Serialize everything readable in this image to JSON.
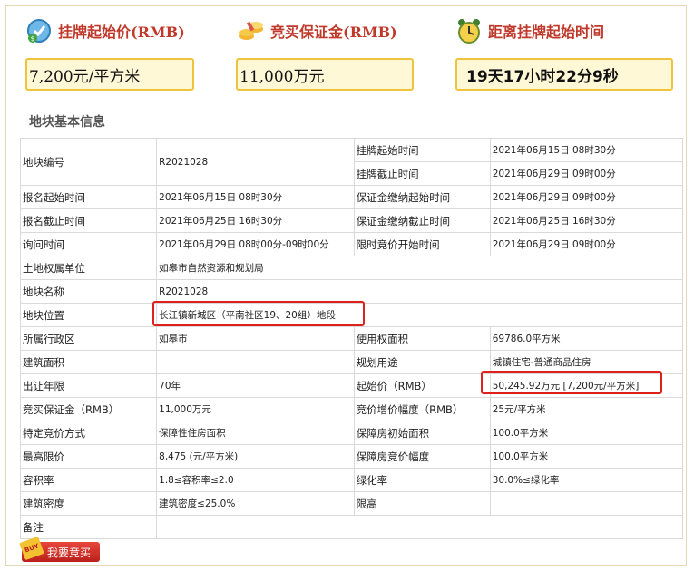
{
  "summary": {
    "start_price": {
      "title": "挂牌起始价(RMB)",
      "value": "7,200元/平方米",
      "icon": "price-tag-icon"
    },
    "deposit": {
      "title": "竞买保证金(RMB)",
      "value": "11,000万元",
      "icon": "coins-icon"
    },
    "countdown": {
      "title": "距离挂牌起始时间",
      "value": "19天17小时22分9秒",
      "icon": "alarm-clock-icon"
    }
  },
  "section_title": "地块基本信息",
  "table": {
    "r1": {
      "l1": "地块编号",
      "v1": "R2021028",
      "l2": "挂牌起始时间",
      "v2": "2021年06月15日 08时30分"
    },
    "r1b": {
      "l2": "挂牌截止时间",
      "v2": "2021年06月29日 09时00分"
    },
    "r2": {
      "l1": "报名起始时间",
      "v1": "2021年06月15日 08时30分",
      "l2": "保证金缴纳起始时间",
      "v2": "2021年06月29日 09时00分"
    },
    "r3": {
      "l1": "报名截止时间",
      "v1": "2021年06月25日 16时30分",
      "l2": "保证金缴纳截止时间",
      "v2": "2021年06月25日 16时30分"
    },
    "r4": {
      "l1": "询问时间",
      "v1": "2021年06月29日 08时00分-09时00分",
      "l2": "限时竞价开始时间",
      "v2": "2021年06月29日 09时00分"
    },
    "r5": {
      "l1": "土地权属单位",
      "v1": "如皋市自然资源和规划局"
    },
    "r6": {
      "l1": "地块名称",
      "v1": "R2021028"
    },
    "r7": {
      "l1": "地块位置",
      "v1": "长江镇新城区（平南社区19、20组）地段"
    },
    "r8": {
      "l1": "所属行政区",
      "v1": "如皋市",
      "l2": "使用权面积",
      "v2": "69786.0平方米"
    },
    "r9": {
      "l1": "建筑面积",
      "v1": "",
      "l2": "规划用途",
      "v2": "城镇住宅-普通商品住房"
    },
    "r10": {
      "l1": "出让年限",
      "v1": "70年",
      "l2": "起始价（RMB）",
      "v2": "50,245.92万元 [7,200元/平方米]"
    },
    "r11": {
      "l1": "竞买保证金（RMB）",
      "v1": "11,000万元",
      "l2": "竞价增价幅度（RMB）",
      "v2": "25元/平方米"
    },
    "r12": {
      "l1": "特定竞价方式",
      "v1": "保障性住房面积",
      "l2": "保障房初始面积",
      "v2": "100.0平方米"
    },
    "r13": {
      "l1": "最高限价",
      "v1": "8,475 (元/平方米)",
      "l2": "保障房竞价幅度",
      "v2": "100.0平方米"
    },
    "r14": {
      "l1": "容积率",
      "v1": "1.8≤容积率≤2.0",
      "l2": "绿化率",
      "v2": "30.0%≤绿化率"
    },
    "r15": {
      "l1": "建筑密度",
      "v1": "建筑密度≤25.0%",
      "l2": "限高",
      "v2": ""
    },
    "r16": {
      "l1": "备注",
      "v1": ""
    }
  },
  "buy_button": {
    "label": "我要竞买",
    "badge": "BUY"
  },
  "colors": {
    "title_red": "#c0392b",
    "box_fill": "#fff8d6",
    "box_border": "#f0c33c",
    "highlight": "#e0201c"
  }
}
